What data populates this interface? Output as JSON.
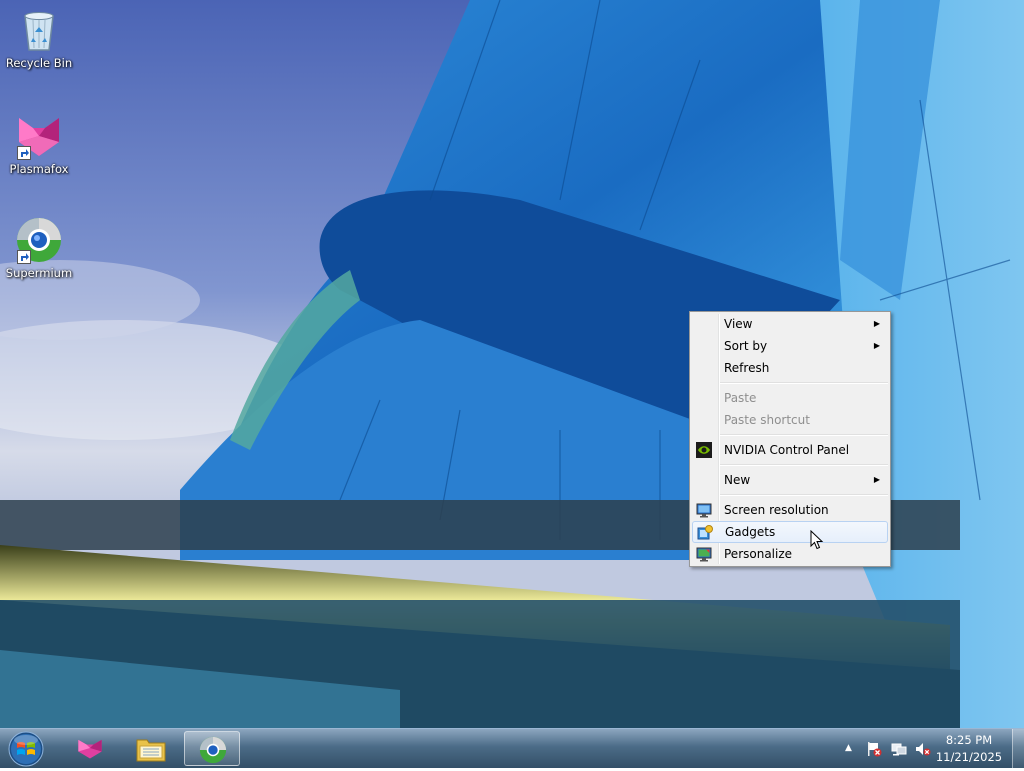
{
  "desktop": {
    "icons": [
      {
        "label": "Recycle Bin",
        "icon": "recycle-bin-icon"
      },
      {
        "label": "Plasmafox",
        "icon": "plasmafox-icon"
      },
      {
        "label": "Supermium",
        "icon": "supermium-icon"
      }
    ]
  },
  "context_menu": {
    "items": [
      {
        "label": "View",
        "submenu": true,
        "enabled": true
      },
      {
        "label": "Sort by",
        "submenu": true,
        "enabled": true
      },
      {
        "label": "Refresh",
        "submenu": false,
        "enabled": true
      },
      {
        "label": "Paste",
        "submenu": false,
        "enabled": false
      },
      {
        "label": "Paste shortcut",
        "submenu": false,
        "enabled": false
      },
      {
        "label": "NVIDIA Control Panel",
        "icon": "nvidia-icon",
        "enabled": true
      },
      {
        "label": "New",
        "submenu": true,
        "enabled": true
      },
      {
        "label": "Screen resolution",
        "icon": "monitor-icon",
        "enabled": true
      },
      {
        "label": "Gadgets",
        "icon": "gadgets-icon",
        "enabled": true,
        "highlighted": true
      },
      {
        "label": "Personalize",
        "icon": "personalize-icon",
        "enabled": true
      }
    ],
    "submenu_arrow": "▶"
  },
  "taskbar": {
    "pinned": [
      {
        "name": "plasmafox-icon"
      },
      {
        "name": "file-explorer-icon"
      },
      {
        "name": "supermium-icon",
        "active": true
      }
    ],
    "tray": {
      "overflow_label": "▲",
      "time": "8:25 PM",
      "date": "11/21/2025"
    }
  },
  "colors": {
    "menu_bg": "#f0f0f0",
    "menu_highlight": "#e6effb",
    "disabled_text": "#8f8f8f",
    "taskbar": "#3c5f7d"
  }
}
